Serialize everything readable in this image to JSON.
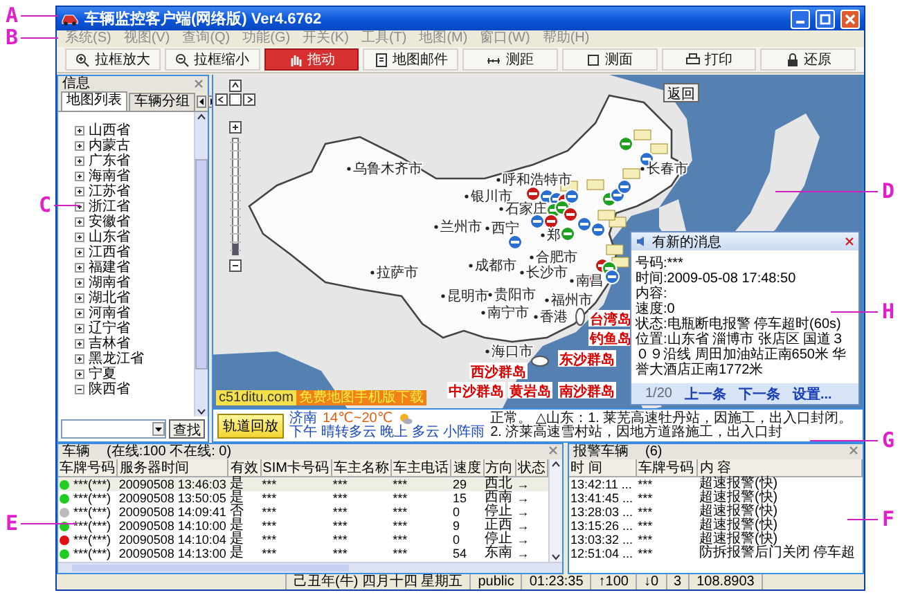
{
  "callouts": [
    {
      "letter": "A"
    },
    {
      "letter": "B"
    },
    {
      "letter": "C"
    },
    {
      "letter": "E"
    },
    {
      "letter": "D"
    },
    {
      "letter": "H"
    },
    {
      "letter": "G"
    },
    {
      "letter": "F"
    }
  ],
  "window": {
    "title": "车辆监控客户端(网络版) Ver4.6762",
    "menu": [
      "系统(S)",
      "视图(V)",
      "查询(Q)",
      "功能(G)",
      "开关(K)",
      "工具(T)",
      "地图(M)",
      "窗口(W)",
      "帮助(H)"
    ],
    "toolbar": [
      {
        "label": "拉框放大",
        "selected": false
      },
      {
        "label": "拉框缩小",
        "selected": false
      },
      {
        "label": "拖动",
        "selected": true
      },
      {
        "label": "地图邮件",
        "selected": false
      },
      {
        "label": "测距",
        "selected": false
      },
      {
        "label": "测面",
        "selected": false
      },
      {
        "label": "打印",
        "selected": false
      },
      {
        "label": "还原",
        "selected": false
      }
    ]
  },
  "side_panel": {
    "title": "信息",
    "tabs": [
      {
        "label": "地图列表",
        "selected": true
      },
      {
        "label": "车辆分组",
        "selected": false
      }
    ],
    "tree": [
      {
        "label": "山西省",
        "expanded": false
      },
      {
        "label": "内蒙古",
        "expanded": false
      },
      {
        "label": "广东省",
        "expanded": false
      },
      {
        "label": "海南省",
        "expanded": false
      },
      {
        "label": "江苏省",
        "expanded": false
      },
      {
        "label": "浙江省",
        "expanded": false
      },
      {
        "label": "安徽省",
        "expanded": false
      },
      {
        "label": "山东省",
        "expanded": false
      },
      {
        "label": "江西省",
        "expanded": false
      },
      {
        "label": "福建省",
        "expanded": false
      },
      {
        "label": "湖南省",
        "expanded": false
      },
      {
        "label": "湖北省",
        "expanded": false
      },
      {
        "label": "河南省",
        "expanded": false
      },
      {
        "label": "辽宁省",
        "expanded": false
      },
      {
        "label": "吉林省",
        "expanded": false
      },
      {
        "label": "黑龙江省",
        "expanded": false
      },
      {
        "label": "宁夏",
        "expanded": false
      },
      {
        "label": "陕西省",
        "expanded": true
      }
    ],
    "search_button": "查找"
  },
  "map": {
    "return_button": "返回",
    "zoom_slider": {
      "level": 0.1
    },
    "cities": [
      "乌鲁木齐市",
      "呼和浩特市",
      "银川市",
      "石家庄",
      "兰州市",
      "西宁",
      "郑",
      "合肥市",
      "成都市",
      "长沙市",
      "南昌",
      "拉萨市",
      "昆明市",
      "贵阳市",
      "南宁市",
      "香港",
      "福州市",
      "海口市",
      "长春市"
    ],
    "islands": [
      "台湾岛",
      "钓鱼岛",
      "东沙群岛",
      "西沙群岛",
      "中沙群岛",
      "黄岩岛",
      "南沙群岛"
    ],
    "credit": "c51ditu.com",
    "download_link": "免费地图手机版下载",
    "popup": {
      "title": "有新的消息",
      "lines": [
        "号码:***",
        "时间:2009-05-08 17:48:50",
        "内容:",
        "速度:0",
        "状态:电瓶断电报警 停车超时(60s)",
        "位置:山东省 淄博市 张店区 国道３０９沿线 周田加油站正南650米 华誉大酒店正南1772米"
      ],
      "page": "1/20",
      "links": [
        "上一条",
        "下一条",
        "设置..."
      ]
    }
  },
  "info_bar": {
    "playback_button": "轨道回放",
    "weather_city": "济南",
    "temperature": "14℃~20℃",
    "forecast": "下午 晴转多云 晚上 多云 小阵雨",
    "ticker": "正常。 △山东：1. 莱芜高速牡丹站，因施工，出入口封闭。 2. 济莱高速雪村站，因地方道路施工，出入口封"
  },
  "vehicles": {
    "title": "车辆",
    "summary": "(在线:100 不在线: 0)",
    "columns": [
      "车牌号码",
      "服务器时间",
      "有效",
      "SIM卡号码",
      "车主名称",
      "车主电话",
      "速度",
      "方向",
      "状态"
    ],
    "rows": [
      {
        "color": "#22cc22",
        "cells": [
          "***(***)",
          "20090508 13:46:03",
          "是",
          "***",
          "***",
          "***",
          "29",
          "西北",
          "→"
        ]
      },
      {
        "color": "#22cc22",
        "cells": [
          "***(***)",
          "20090508 13:50:05",
          "是",
          "***",
          "***",
          "***",
          "15",
          "西南",
          "→"
        ]
      },
      {
        "color": "#bbbbbb",
        "cells": [
          "***(***)",
          "20090508 14:09:41",
          "否",
          "***",
          "***",
          "***",
          "0",
          "停止",
          "→"
        ]
      },
      {
        "color": "#22cc22",
        "cells": [
          "***(***)",
          "20090508 14:10:00",
          "是",
          "***",
          "***",
          "***",
          "9",
          "正西",
          "→"
        ]
      },
      {
        "color": "#dd1111",
        "cells": [
          "***(***)",
          "20090508 14:10:04",
          "是",
          "***",
          "***",
          "***",
          "0",
          "停止",
          "→"
        ]
      },
      {
        "color": "#22cc22",
        "cells": [
          "***(***)",
          "20090508 14:13:00",
          "是",
          "***",
          "***",
          "***",
          "54",
          "东南",
          "→"
        ]
      }
    ]
  },
  "alarms": {
    "title": "报警车辆",
    "count": "(6)",
    "columns": [
      "时 间",
      "车牌号码",
      "内 容"
    ],
    "rows": [
      [
        "13:42:11 ...",
        "***",
        "超速报警(快)"
      ],
      [
        "13:41:45 ...",
        "***",
        "超速报警(快)"
      ],
      [
        "13:28:03 ...",
        "***",
        "超速报警(快)"
      ],
      [
        "13:15:26 ...",
        "***",
        "超速报警(快)"
      ],
      [
        "13:03:32 ...",
        "***",
        "超速报警(快)"
      ],
      [
        "12:51:04 ...",
        "***",
        "防拆报警后门关闭 停车超"
      ]
    ]
  },
  "status_bar": [
    "己丑年(牛) 四月十四 星期五",
    "public",
    "01:23:35",
    "↑100",
    "↓0",
    "3",
    "108.8903"
  ]
}
